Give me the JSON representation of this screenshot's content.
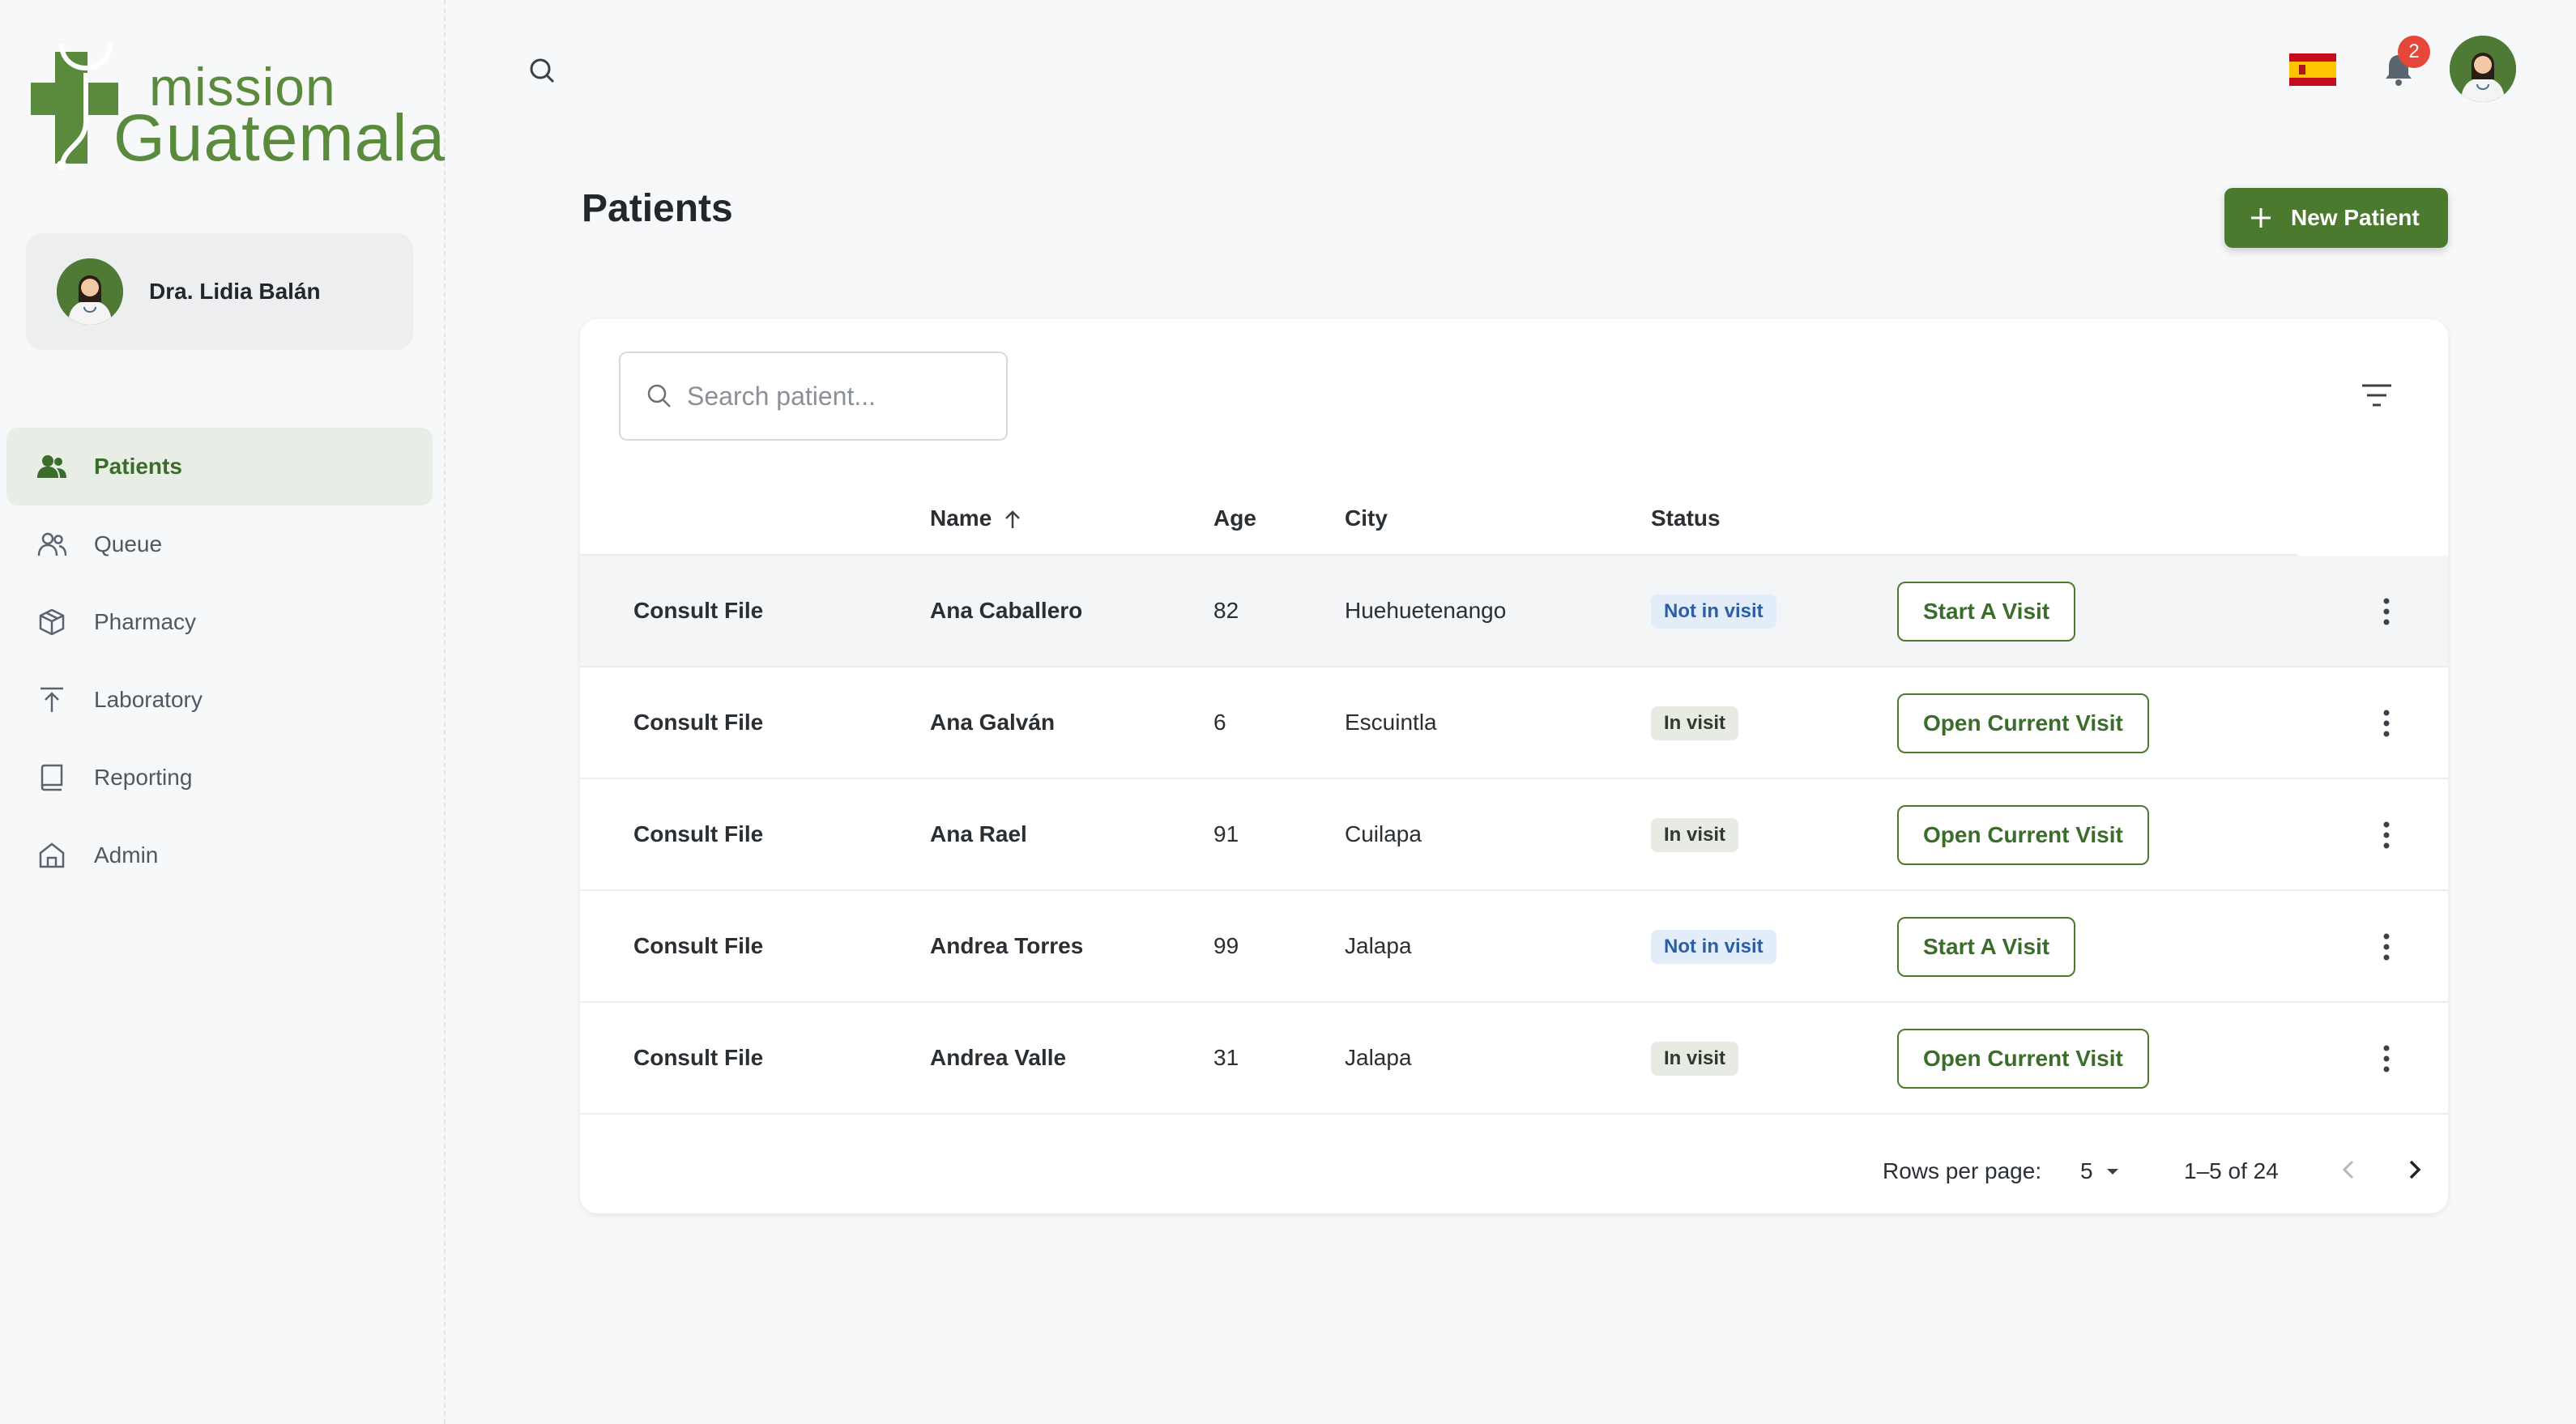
{
  "logo": {
    "line1": "mission",
    "line2": "Guatemala"
  },
  "user": {
    "name": "Dra. Lidia Balán"
  },
  "nav": [
    {
      "label": "Patients",
      "icon": "users-icon",
      "active": true
    },
    {
      "label": "Queue",
      "icon": "queue-icon"
    },
    {
      "label": "Pharmacy",
      "icon": "box-icon"
    },
    {
      "label": "Laboratory",
      "icon": "upload-icon"
    },
    {
      "label": "Reporting",
      "icon": "book-icon"
    },
    {
      "label": "Admin",
      "icon": "home-icon"
    }
  ],
  "topbar": {
    "notification_count": "2"
  },
  "page": {
    "title": "Patients",
    "new_button": "New Patient"
  },
  "search": {
    "placeholder": "Search patient..."
  },
  "table": {
    "headers": {
      "name": "Name",
      "age": "Age",
      "city": "City",
      "status": "Status"
    },
    "rows": [
      {
        "consult": "Consult File",
        "name": "Ana Caballero",
        "age": "82",
        "city": "Huehuetenango",
        "status": "Not in visit",
        "action": "Start A Visit"
      },
      {
        "consult": "Consult File",
        "name": "Ana Galván",
        "age": "6",
        "city": "Escuintla",
        "status": "In visit",
        "action": "Open Current Visit"
      },
      {
        "consult": "Consult File",
        "name": "Ana Rael",
        "age": "91",
        "city": "Cuilapa",
        "status": "In visit",
        "action": "Open Current Visit"
      },
      {
        "consult": "Consult File",
        "name": "Andrea Torres",
        "age": "99",
        "city": "Jalapa",
        "status": "Not in visit",
        "action": "Start A Visit"
      },
      {
        "consult": "Consult File",
        "name": "Andrea Valle",
        "age": "31",
        "city": "Jalapa",
        "status": "In visit",
        "action": "Open Current Visit"
      }
    ]
  },
  "pagination": {
    "rows_per_page_label": "Rows per page:",
    "rows_per_page": "5",
    "range": "1–5 of 24"
  },
  "colors": {
    "brand": "#4b7a2f",
    "badge": "#e5483b"
  }
}
